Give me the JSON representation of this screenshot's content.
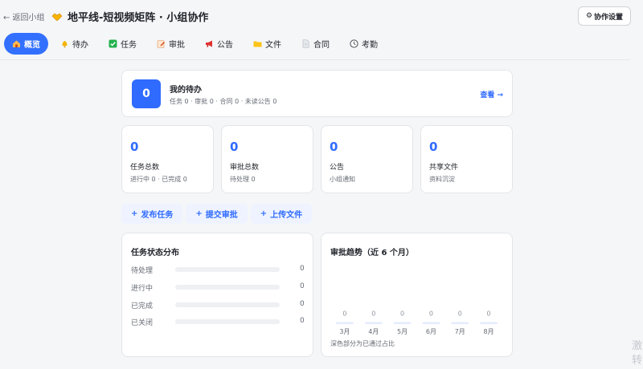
{
  "header": {
    "back_label": "← 返回小组",
    "title": "地平线-短视频矩阵 · 小组协作",
    "settings_label": "协作设置"
  },
  "tabs": [
    {
      "label": "概览",
      "icon": "home-icon",
      "active": true
    },
    {
      "label": "待办",
      "icon": "bell-icon",
      "active": false
    },
    {
      "label": "任务",
      "icon": "check-square-icon",
      "active": false
    },
    {
      "label": "审批",
      "icon": "pencil-note-icon",
      "active": false
    },
    {
      "label": "公告",
      "icon": "megaphone-icon",
      "active": false
    },
    {
      "label": "文件",
      "icon": "folder-icon",
      "active": false
    },
    {
      "label": "合同",
      "icon": "document-icon",
      "active": false
    },
    {
      "label": "考勤",
      "icon": "clock-icon",
      "active": false
    }
  ],
  "todo": {
    "count": "0",
    "title": "我的待办",
    "summary": "任务 0 · 审批 0 · 合同 0 · 未读公告 0",
    "link_label": "查看 →"
  },
  "stats": [
    {
      "value": "0",
      "label": "任务总数",
      "sub": "进行中 0 · 已完成 0"
    },
    {
      "value": "0",
      "label": "审批总数",
      "sub": "待处理 0"
    },
    {
      "value": "0",
      "label": "公告",
      "sub": "小组通知"
    },
    {
      "value": "0",
      "label": "共享文件",
      "sub": "资料沉淀"
    }
  ],
  "actions": [
    {
      "label": "发布任务"
    },
    {
      "label": "提交审批"
    },
    {
      "label": "上传文件"
    }
  ],
  "task_status": {
    "title": "任务状态分布",
    "rows": [
      {
        "label": "待处理",
        "count": "0",
        "fraction": 0
      },
      {
        "label": "进行中",
        "count": "0",
        "fraction": 0
      },
      {
        "label": "已完成",
        "count": "0",
        "fraction": 0
      },
      {
        "label": "已关闭",
        "count": "0",
        "fraction": 0
      }
    ]
  },
  "approval_trend": {
    "title": "审批趋势（近 6 个月）",
    "note": "深色部分为已通过占比"
  },
  "chart_data": {
    "type": "bar",
    "categories": [
      "3月",
      "4月",
      "5月",
      "6月",
      "7月",
      "8月"
    ],
    "values": [
      0,
      0,
      0,
      0,
      0,
      0
    ],
    "data_labels": [
      "0",
      "0",
      "0",
      "0",
      "0",
      "0"
    ]
  },
  "watermark": {
    "line1": "激",
    "line2": "转"
  },
  "colors": {
    "accent": "#3370ff",
    "accent_soft": "#eef3ff"
  }
}
